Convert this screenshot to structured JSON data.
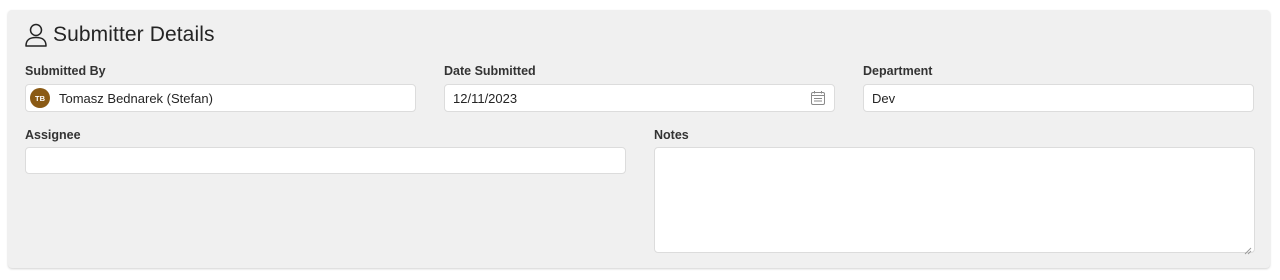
{
  "section": {
    "title": "Submitter Details",
    "icon": "person-icon"
  },
  "submitted_by": {
    "label": "Submitted By",
    "avatar_initials": "TB",
    "avatar_color": "#8a5a14",
    "value": "Tomasz Bednarek (Stefan)"
  },
  "date_submitted": {
    "label": "Date Submitted",
    "value": "12/11/2023",
    "icon": "calendar-icon"
  },
  "department": {
    "label": "Department",
    "value": "Dev"
  },
  "assignee": {
    "label": "Assignee",
    "value": ""
  },
  "notes": {
    "label": "Notes",
    "value": ""
  }
}
